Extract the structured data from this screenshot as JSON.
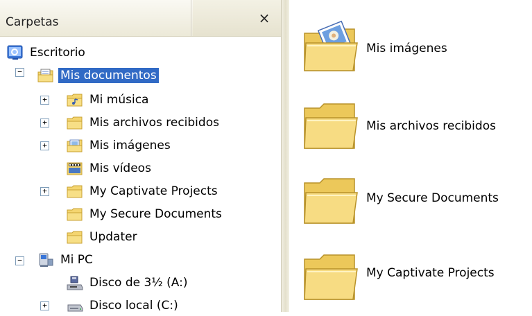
{
  "folders_pane": {
    "title": "Carpetas",
    "close_glyph": "×",
    "tree": [
      {
        "label": "Escritorio",
        "icon": "desktop-icon",
        "expander": ""
      },
      {
        "label": "Mis documentos",
        "icon": "my-documents-icon",
        "expander": "−",
        "selected": true
      },
      {
        "label": "Mi música",
        "icon": "music-folder-icon",
        "expander": "+"
      },
      {
        "label": "Mis archivos recibidos",
        "icon": "folder-icon",
        "expander": "+"
      },
      {
        "label": "Mis imágenes",
        "icon": "pictures-folder-icon",
        "expander": "+"
      },
      {
        "label": "Mis vídeos",
        "icon": "videos-folder-icon",
        "expander": ""
      },
      {
        "label": "My Captivate Projects",
        "icon": "folder-icon",
        "expander": "+"
      },
      {
        "label": "My Secure Documents",
        "icon": "folder-icon",
        "expander": ""
      },
      {
        "label": "Updater",
        "icon": "folder-icon",
        "expander": ""
      },
      {
        "label": "Mi PC",
        "icon": "my-computer-icon",
        "expander": "−"
      },
      {
        "label": "Disco de 3½ (A:)",
        "icon": "floppy-drive-icon",
        "expander": ""
      },
      {
        "label": "Disco local (C:)",
        "icon": "hard-drive-icon",
        "expander": "+"
      }
    ]
  },
  "content_pane": {
    "items": [
      {
        "label": "Mis imágenes",
        "icon": "pictures-folder-large-icon"
      },
      {
        "label": "Mis archivos recibidos",
        "icon": "folder-large-icon"
      },
      {
        "label": "My Secure Documents",
        "icon": "folder-large-icon"
      },
      {
        "label": "My Captivate Projects",
        "icon": "folder-large-icon"
      }
    ]
  },
  "colors": {
    "selection": "#316ac5",
    "folder_yellow": "#f5d96b",
    "pane_header": "#ece9d8"
  }
}
